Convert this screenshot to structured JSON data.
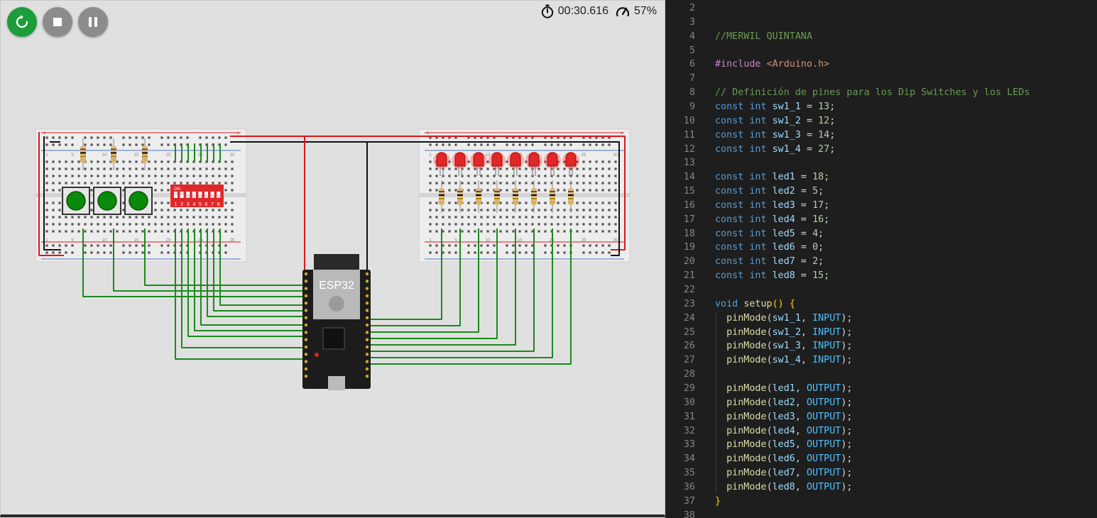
{
  "simulator": {
    "timer": "00:30.616",
    "speed": "57%",
    "controls": {
      "restart": "restart",
      "stop": "stop",
      "pause": "pause"
    },
    "esp32_label": "ESP32",
    "dip_switch_label": "ON",
    "dip_switch_numbers": [
      "1",
      "2",
      "3",
      "4",
      "5",
      "6",
      "7",
      "8"
    ],
    "breadboard_left_numbers": [
      "1",
      "5",
      "10",
      "15",
      "20",
      "25",
      "30"
    ],
    "breadboard_right_numbers": [
      "1",
      "5",
      "10",
      "15",
      "20",
      "25",
      "30"
    ],
    "colors": {
      "wire_red": "#d9181b",
      "wire_black": "#111111",
      "wire_green": "#1b8a1b",
      "led_red": "#e0282a",
      "button_green": "#0a8a0a",
      "esp_board": "#1c1c1c"
    }
  },
  "editor": {
    "lines": [
      {
        "n": "2",
        "tokens": []
      },
      {
        "n": "3",
        "tokens": []
      },
      {
        "n": "4",
        "tokens": [
          [
            "c",
            "//MERWIL QUINTANA"
          ]
        ]
      },
      {
        "n": "5",
        "tokens": []
      },
      {
        "n": "6",
        "tokens": [
          [
            "m",
            "#include"
          ],
          [
            "p",
            " "
          ],
          [
            "s",
            "<Arduino.h>"
          ]
        ]
      },
      {
        "n": "7",
        "tokens": []
      },
      {
        "n": "8",
        "tokens": [
          [
            "c",
            "// Definición de pines para los Dip Switches y los LEDs"
          ]
        ]
      },
      {
        "n": "9",
        "tokens": [
          [
            "k",
            "const"
          ],
          [
            "p",
            " "
          ],
          [
            "k",
            "int"
          ],
          [
            "p",
            " "
          ],
          [
            "v",
            "sw1_1"
          ],
          [
            "p",
            " = "
          ],
          [
            "d",
            "13"
          ],
          [
            "p",
            ";"
          ]
        ]
      },
      {
        "n": "10",
        "tokens": [
          [
            "k",
            "const"
          ],
          [
            "p",
            " "
          ],
          [
            "k",
            "int"
          ],
          [
            "p",
            " "
          ],
          [
            "v",
            "sw1_2"
          ],
          [
            "p",
            " = "
          ],
          [
            "d",
            "12"
          ],
          [
            "p",
            ";"
          ]
        ]
      },
      {
        "n": "11",
        "tokens": [
          [
            "k",
            "const"
          ],
          [
            "p",
            " "
          ],
          [
            "k",
            "int"
          ],
          [
            "p",
            " "
          ],
          [
            "v",
            "sw1_3"
          ],
          [
            "p",
            " = "
          ],
          [
            "d",
            "14"
          ],
          [
            "p",
            ";"
          ]
        ]
      },
      {
        "n": "12",
        "tokens": [
          [
            "k",
            "const"
          ],
          [
            "p",
            " "
          ],
          [
            "k",
            "int"
          ],
          [
            "p",
            " "
          ],
          [
            "v",
            "sw1_4"
          ],
          [
            "p",
            " = "
          ],
          [
            "d",
            "27"
          ],
          [
            "p",
            ";"
          ]
        ]
      },
      {
        "n": "13",
        "tokens": []
      },
      {
        "n": "14",
        "tokens": [
          [
            "k",
            "const"
          ],
          [
            "p",
            " "
          ],
          [
            "k",
            "int"
          ],
          [
            "p",
            " "
          ],
          [
            "v",
            "led1"
          ],
          [
            "p",
            " = "
          ],
          [
            "d",
            "18"
          ],
          [
            "p",
            ";"
          ]
        ]
      },
      {
        "n": "15",
        "tokens": [
          [
            "k",
            "const"
          ],
          [
            "p",
            " "
          ],
          [
            "k",
            "int"
          ],
          [
            "p",
            " "
          ],
          [
            "v",
            "led2"
          ],
          [
            "p",
            " = "
          ],
          [
            "d",
            "5"
          ],
          [
            "p",
            ";"
          ]
        ]
      },
      {
        "n": "16",
        "tokens": [
          [
            "k",
            "const"
          ],
          [
            "p",
            " "
          ],
          [
            "k",
            "int"
          ],
          [
            "p",
            " "
          ],
          [
            "v",
            "led3"
          ],
          [
            "p",
            " = "
          ],
          [
            "d",
            "17"
          ],
          [
            "p",
            ";"
          ]
        ]
      },
      {
        "n": "17",
        "tokens": [
          [
            "k",
            "const"
          ],
          [
            "p",
            " "
          ],
          [
            "k",
            "int"
          ],
          [
            "p",
            " "
          ],
          [
            "v",
            "led4"
          ],
          [
            "p",
            " = "
          ],
          [
            "d",
            "16"
          ],
          [
            "p",
            ";"
          ]
        ]
      },
      {
        "n": "18",
        "tokens": [
          [
            "k",
            "const"
          ],
          [
            "p",
            " "
          ],
          [
            "k",
            "int"
          ],
          [
            "p",
            " "
          ],
          [
            "v",
            "led5"
          ],
          [
            "p",
            " = "
          ],
          [
            "d",
            "4"
          ],
          [
            "p",
            ";"
          ]
        ]
      },
      {
        "n": "19",
        "tokens": [
          [
            "k",
            "const"
          ],
          [
            "p",
            " "
          ],
          [
            "k",
            "int"
          ],
          [
            "p",
            " "
          ],
          [
            "v",
            "led6"
          ],
          [
            "p",
            " = "
          ],
          [
            "d",
            "0"
          ],
          [
            "p",
            ";"
          ]
        ]
      },
      {
        "n": "20",
        "tokens": [
          [
            "k",
            "const"
          ],
          [
            "p",
            " "
          ],
          [
            "k",
            "int"
          ],
          [
            "p",
            " "
          ],
          [
            "v",
            "led7"
          ],
          [
            "p",
            " = "
          ],
          [
            "d",
            "2"
          ],
          [
            "p",
            ";"
          ]
        ]
      },
      {
        "n": "21",
        "tokens": [
          [
            "k",
            "const"
          ],
          [
            "p",
            " "
          ],
          [
            "k",
            "int"
          ],
          [
            "p",
            " "
          ],
          [
            "v",
            "led8"
          ],
          [
            "p",
            " = "
          ],
          [
            "d",
            "15"
          ],
          [
            "p",
            ";"
          ]
        ]
      },
      {
        "n": "22",
        "tokens": []
      },
      {
        "n": "23",
        "tokens": [
          [
            "k",
            "void"
          ],
          [
            "p",
            " "
          ],
          [
            "f",
            "setup"
          ],
          [
            "b",
            "()"
          ],
          [
            "p",
            " "
          ],
          [
            "b",
            "{"
          ]
        ]
      },
      {
        "n": "24",
        "tokens": [
          [
            "p",
            "  "
          ],
          [
            "f",
            "pinMode"
          ],
          [
            "p",
            "("
          ],
          [
            "v",
            "sw1_1"
          ],
          [
            "p",
            ", "
          ],
          [
            "o",
            "INPUT"
          ],
          [
            "p",
            ");"
          ]
        ]
      },
      {
        "n": "25",
        "tokens": [
          [
            "p",
            "  "
          ],
          [
            "f",
            "pinMode"
          ],
          [
            "p",
            "("
          ],
          [
            "v",
            "sw1_2"
          ],
          [
            "p",
            ", "
          ],
          [
            "o",
            "INPUT"
          ],
          [
            "p",
            ");"
          ]
        ]
      },
      {
        "n": "26",
        "tokens": [
          [
            "p",
            "  "
          ],
          [
            "f",
            "pinMode"
          ],
          [
            "p",
            "("
          ],
          [
            "v",
            "sw1_3"
          ],
          [
            "p",
            ", "
          ],
          [
            "o",
            "INPUT"
          ],
          [
            "p",
            ");"
          ]
        ]
      },
      {
        "n": "27",
        "tokens": [
          [
            "p",
            "  "
          ],
          [
            "f",
            "pinMode"
          ],
          [
            "p",
            "("
          ],
          [
            "v",
            "sw1_4"
          ],
          [
            "p",
            ", "
          ],
          [
            "o",
            "INPUT"
          ],
          [
            "p",
            ");"
          ]
        ]
      },
      {
        "n": "28",
        "tokens": []
      },
      {
        "n": "29",
        "tokens": [
          [
            "p",
            "  "
          ],
          [
            "f",
            "pinMode"
          ],
          [
            "p",
            "("
          ],
          [
            "v",
            "led1"
          ],
          [
            "p",
            ", "
          ],
          [
            "o",
            "OUTPUT"
          ],
          [
            "p",
            ");"
          ]
        ]
      },
      {
        "n": "30",
        "tokens": [
          [
            "p",
            "  "
          ],
          [
            "f",
            "pinMode"
          ],
          [
            "p",
            "("
          ],
          [
            "v",
            "led2"
          ],
          [
            "p",
            ", "
          ],
          [
            "o",
            "OUTPUT"
          ],
          [
            "p",
            ");"
          ]
        ]
      },
      {
        "n": "31",
        "tokens": [
          [
            "p",
            "  "
          ],
          [
            "f",
            "pinMode"
          ],
          [
            "p",
            "("
          ],
          [
            "v",
            "led3"
          ],
          [
            "p",
            ", "
          ],
          [
            "o",
            "OUTPUT"
          ],
          [
            "p",
            ");"
          ]
        ]
      },
      {
        "n": "32",
        "tokens": [
          [
            "p",
            "  "
          ],
          [
            "f",
            "pinMode"
          ],
          [
            "p",
            "("
          ],
          [
            "v",
            "led4"
          ],
          [
            "p",
            ", "
          ],
          [
            "o",
            "OUTPUT"
          ],
          [
            "p",
            ");"
          ]
        ]
      },
      {
        "n": "33",
        "tokens": [
          [
            "p",
            "  "
          ],
          [
            "f",
            "pinMode"
          ],
          [
            "p",
            "("
          ],
          [
            "v",
            "led5"
          ],
          [
            "p",
            ", "
          ],
          [
            "o",
            "OUTPUT"
          ],
          [
            "p",
            ");"
          ]
        ]
      },
      {
        "n": "34",
        "tokens": [
          [
            "p",
            "  "
          ],
          [
            "f",
            "pinMode"
          ],
          [
            "p",
            "("
          ],
          [
            "v",
            "led6"
          ],
          [
            "p",
            ", "
          ],
          [
            "o",
            "OUTPUT"
          ],
          [
            "p",
            ");"
          ]
        ]
      },
      {
        "n": "35",
        "tokens": [
          [
            "p",
            "  "
          ],
          [
            "f",
            "pinMode"
          ],
          [
            "p",
            "("
          ],
          [
            "v",
            "led7"
          ],
          [
            "p",
            ", "
          ],
          [
            "o",
            "OUTPUT"
          ],
          [
            "p",
            ");"
          ]
        ]
      },
      {
        "n": "36",
        "tokens": [
          [
            "p",
            "  "
          ],
          [
            "f",
            "pinMode"
          ],
          [
            "p",
            "("
          ],
          [
            "v",
            "led8"
          ],
          [
            "p",
            ", "
          ],
          [
            "o",
            "OUTPUT"
          ],
          [
            "p",
            ");"
          ]
        ]
      },
      {
        "n": "37",
        "tokens": [
          [
            "b",
            "}"
          ]
        ]
      },
      {
        "n": "38",
        "tokens": []
      }
    ]
  }
}
